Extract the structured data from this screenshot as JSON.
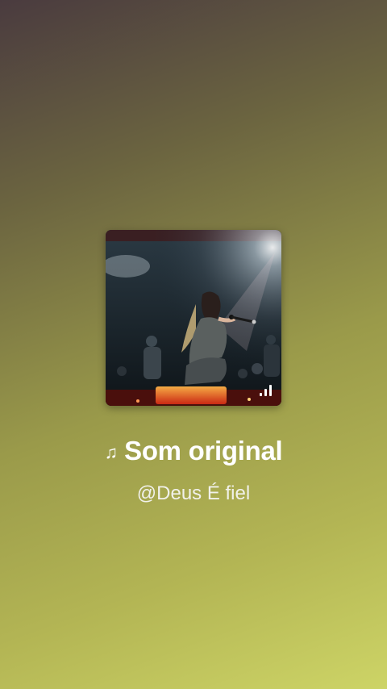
{
  "sound": {
    "title": "Som original",
    "author": "@Deus É fiel",
    "note_icon": "music-note-icon",
    "playing_icon": "audio-bars-icon"
  },
  "colors": {
    "text": "#ffffff",
    "bg_top": "#4a3b3f",
    "bg_bottom": "#cdd466"
  }
}
